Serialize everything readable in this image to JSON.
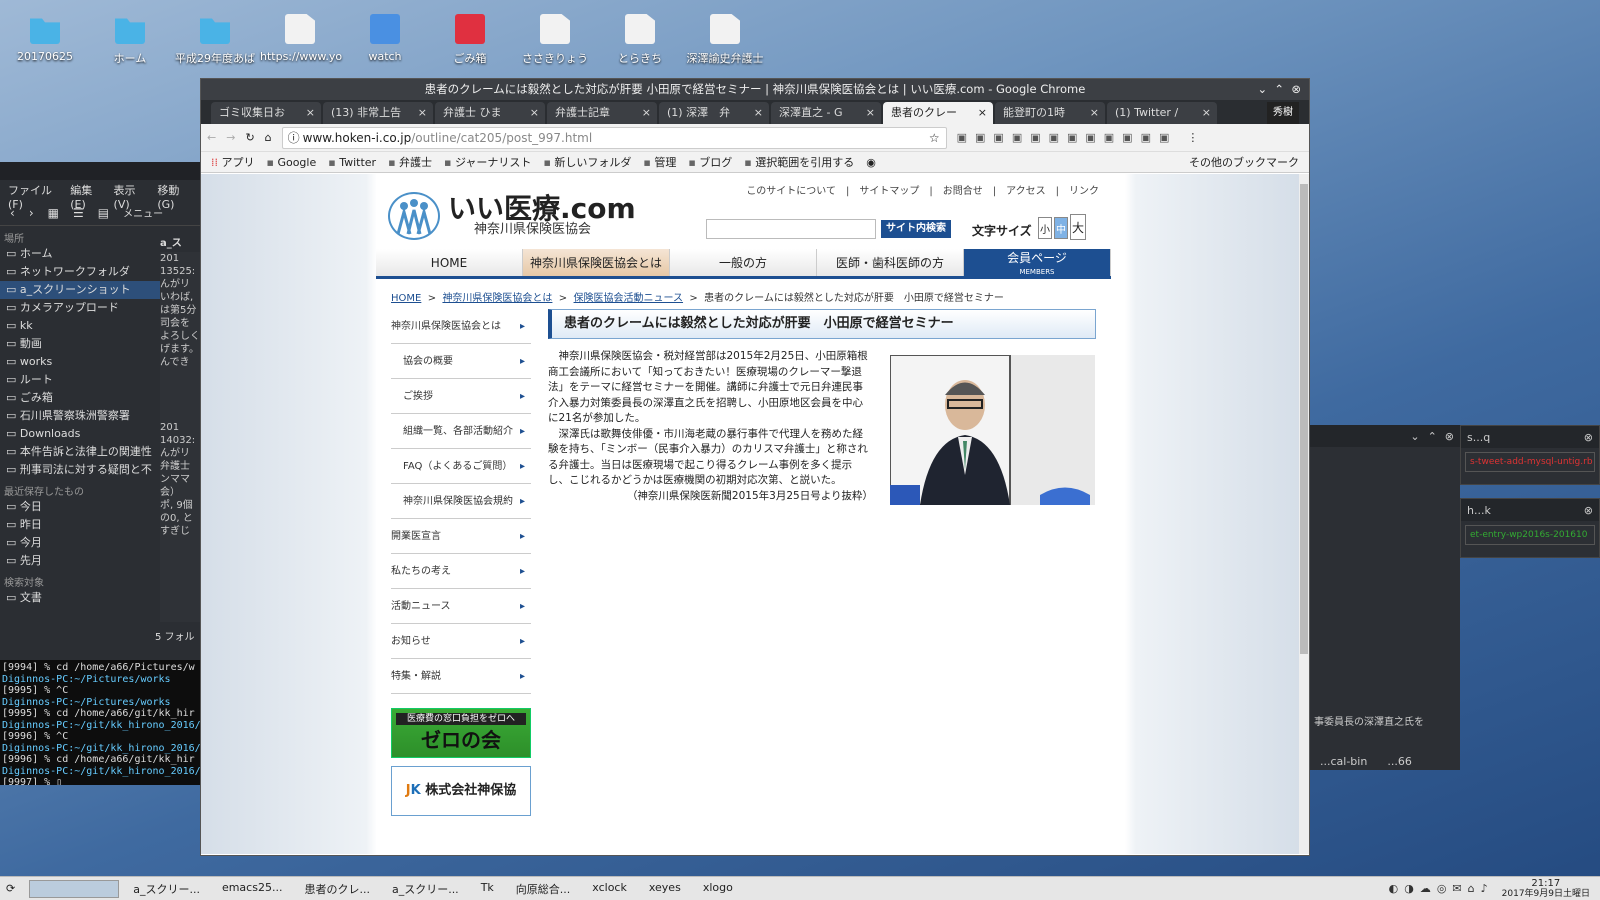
{
  "desktop": {
    "icons": [
      {
        "label": "20170625",
        "type": "folder"
      },
      {
        "label": "ホーム",
        "type": "folder"
      },
      {
        "label": "平成29年度あば",
        "type": "folder"
      },
      {
        "label": "https://www.yo",
        "type": "doc"
      },
      {
        "label": "watch",
        "type": "globe"
      },
      {
        "label": "ごみ箱",
        "type": "trash"
      },
      {
        "label": "ささきりょう",
        "type": "doc"
      },
      {
        "label": "とらきち",
        "type": "doc"
      },
      {
        "label": "深澤諭史弁護士",
        "type": "doc"
      }
    ]
  },
  "filemanager": {
    "menus": [
      "ファイル(F)",
      "編集(E)",
      "表示(V)",
      "移動(G)"
    ],
    "toolbar_label": "メニュー",
    "places_label": "場所",
    "places": [
      "ホーム",
      "ネットワークフォルダ",
      "a_スクリーンショット",
      "カメラアップロード",
      "kk",
      "動画",
      "works",
      "ルート",
      "ごみ箱",
      "石川県警察珠洲警察署",
      "Downloads",
      "本件告訴と法律上の関連性",
      "刑事司法に対する疑問と不"
    ],
    "recent_label": "最近保存したもの",
    "recent": [
      "今日",
      "昨日",
      "今月",
      "先月"
    ],
    "search_label": "検索対象",
    "search": [
      "文書"
    ],
    "pane_header": "a_ス",
    "pane_text": [
      "201",
      "13525:",
      "んがリ",
      "いわば,",
      "は第5分",
      "司会を",
      "よろしく",
      "げます。",
      "んでき",
      "201",
      "14032:",
      "んがリ",
      "弁護士",
      "ンママ",
      "会）",
      "ポ, 9個",
      "の0, と",
      "すぎじ"
    ],
    "status": "5 フォル"
  },
  "terminal": {
    "lines": [
      {
        "t": "[9994]  %  cd /home/a66/Pictures/w",
        "c": ""
      },
      {
        "t": "Diginnos-PC:~/Pictures/works",
        "c": "g"
      },
      {
        "t": "[9995]  % ^C",
        "c": ""
      },
      {
        "t": "Diginnos-PC:~/Pictures/works",
        "c": "g"
      },
      {
        "t": "[9995]  %  cd /home/a66/git/kk_hir",
        "c": ""
      },
      {
        "t": "Diginnos-PC:~/git/kk_hirono_2016/a",
        "c": "g"
      },
      {
        "t": "[9996]  % ^C",
        "c": ""
      },
      {
        "t": "Diginnos-PC:~/git/kk_hirono_2016/a",
        "c": "g"
      },
      {
        "t": "[9996]  %  cd /home/a66/git/kk_hir",
        "c": ""
      },
      {
        "t": "Diginnos-PC:~/git/kk_hirono_2016/a",
        "c": "g"
      },
      {
        "t": "[9997]  % ▯",
        "c": ""
      }
    ]
  },
  "rightpanels": {
    "p1_text": "事委員長の深澤直之氏を",
    "p1_tabs": [
      "...cal-bin",
      "...66"
    ],
    "p2_title": "s...q",
    "p2_text": "s-tweet-add-mysql-untig.rb",
    "p3_title": "h...k",
    "p3_text": "et-entry-wp2016s-201610"
  },
  "chrome": {
    "title": "患者のクレームには毅然とした対応が肝要 小田原で経営セミナー | 神奈川県保険医協会とは | いい医療.com - Google Chrome",
    "tabs": [
      {
        "label": "ゴミ収集日お",
        "active": false
      },
      {
        "label": "(13) 非常上告",
        "active": false
      },
      {
        "label": "弁護士 ひま",
        "active": false
      },
      {
        "label": "弁護士記章",
        "active": false
      },
      {
        "label": "(1) 深澤　弁",
        "active": false
      },
      {
        "label": "深澤直之 - G",
        "active": false
      },
      {
        "label": "患者のクレー",
        "active": true
      },
      {
        "label": "能登町の1時",
        "active": false
      },
      {
        "label": "(1) Twitter /",
        "active": false
      }
    ],
    "profile": "秀樹",
    "url_domain": "www.hoken-i.co.jp",
    "url_path": "/outline/cat205/post_997.html",
    "bookmarks": [
      "アプリ",
      "Google",
      "Twitter",
      "弁護士",
      "ジャーナリスト",
      "新しいフォルダ",
      "管理",
      "ブログ",
      "選択範囲を引用する"
    ],
    "other_bookmarks": "その他のブックマーク"
  },
  "page": {
    "toplinks": "このサイトについて　|　サイトマップ　|　お問合せ　|　アクセス　|　リンク",
    "logo_title": "いい医療.com",
    "logo_sub": "神奈川県保険医協会",
    "search_btn": "サイト内検索",
    "fontsize_label": "文字サイズ",
    "fontsize_opts": [
      "小",
      "中",
      "大"
    ],
    "nav": [
      "HOME",
      "神奈川県保険医協会とは",
      "一般の方",
      "医師・歯科医師の方"
    ],
    "nav_member": "会員ページ",
    "nav_member_sub": "MEMBERS",
    "crumb": {
      "home": "HOME",
      "c1": "神奈川県保険医協会とは",
      "c2": "保険医協会活動ニュース",
      "current": "患者のクレームには毅然とした対応が肝要　小田原で経営セミナー"
    },
    "side": [
      {
        "label": "神奈川県保険医協会とは",
        "sub": false
      },
      {
        "label": "協会の概要",
        "sub": true
      },
      {
        "label": "ご挨拶",
        "sub": true
      },
      {
        "label": "組織一覧、各部活動紹介",
        "sub": true
      },
      {
        "label": "FAQ（よくあるご質問）",
        "sub": true
      },
      {
        "label": "神奈川県保険医協会規約",
        "sub": true
      },
      {
        "label": "開業医宣言",
        "sub": false
      },
      {
        "label": "私たちの考え",
        "sub": false
      },
      {
        "label": "活動ニュース",
        "sub": false
      },
      {
        "label": "お知らせ",
        "sub": false
      },
      {
        "label": "特集・解説",
        "sub": false
      }
    ],
    "banner1_top": "医療費の窓口負担をゼロへ",
    "banner1_main": "ゼロの会",
    "banner2": "株式会社神保協",
    "article_title": "患者のクレームには毅然とした対応が肝要　小田原で経営セミナー",
    "p1": "神奈川県保険医協会・税対経営部は2015年2月25日、小田原箱根商工会議所において「知っておきたい！医療現場のクレーマー撃退法」をテーマに経営セミナーを開催。講師に弁護士で元日弁連民事介入暴力対策委員長の深澤直之氏を招聘し、小田原地区会員を中心に21名が参加した。",
    "p2": "深澤氏は歌舞伎俳優・市川海老蔵の暴行事件で代理人を務めた経験を持ち、「ミンボー（民事介入暴力）のカリスマ弁護士」と称される弁護士。当日は医療現場で起こり得るクレーム事例を多く提示し、こじれるかどうかは医療機関の初期対応次第、と説いた。",
    "source": "（神奈川県保険医新聞2015年3月25日号より抜粋）"
  },
  "taskbar": {
    "items": [
      "a_スクリー...",
      "emacs25...",
      "患者のクレ...",
      "a_スクリー...",
      "Tk",
      "向原総合...",
      "xclock",
      "xeyes",
      "xlogo"
    ],
    "time": "21:17",
    "date": "2017年9月9日土曜日"
  }
}
